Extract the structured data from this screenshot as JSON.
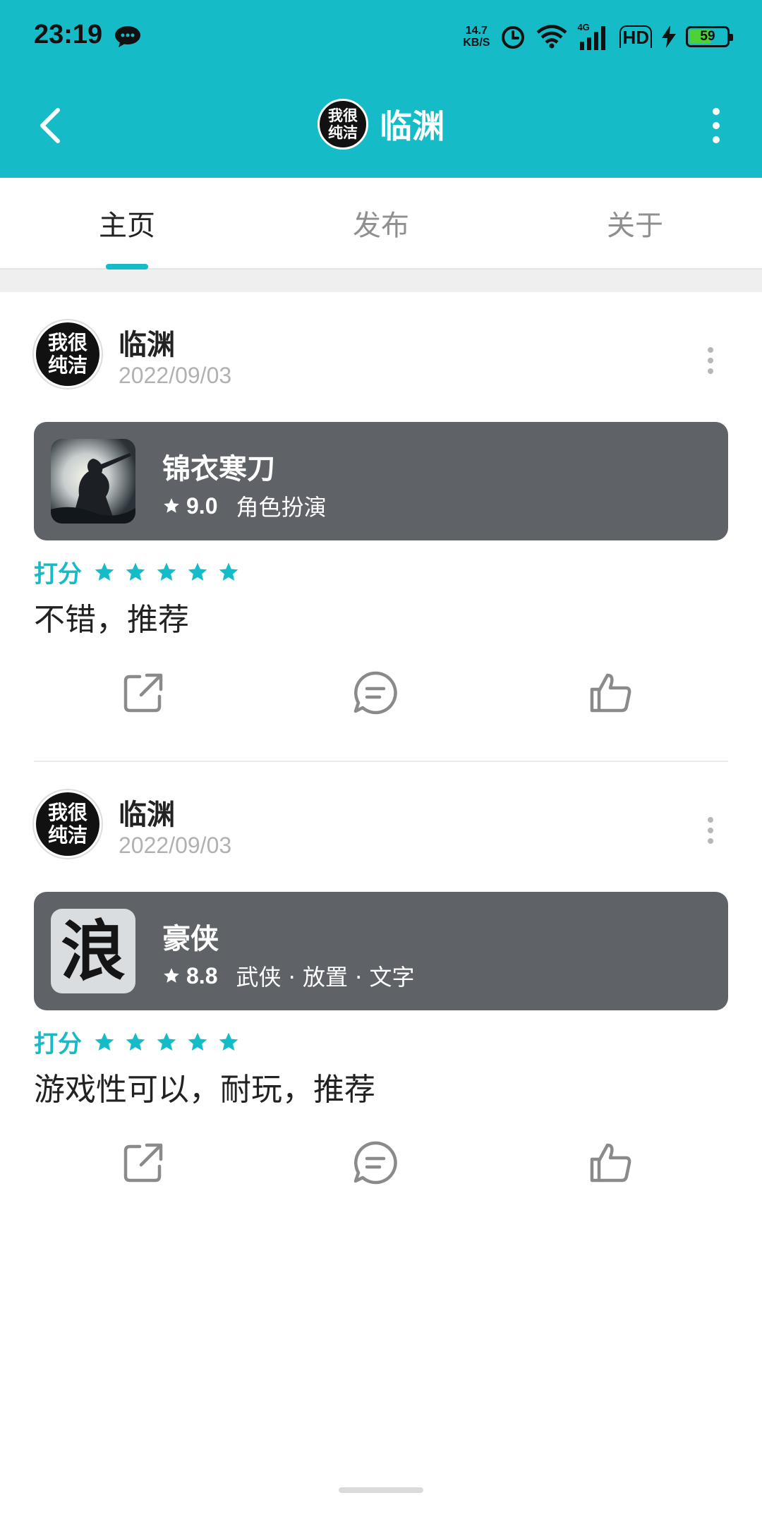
{
  "status_bar": {
    "time": "23:19",
    "net_speed_value": "14.7",
    "net_speed_unit": "KB/S",
    "network_type": "4G",
    "hd": "HD",
    "battery": "59",
    "battery_level": 0.59
  },
  "header": {
    "logo_line1": "我很",
    "logo_line2": "纯洁",
    "title": "临渊"
  },
  "tabs": [
    {
      "label": "主页",
      "active": true
    },
    {
      "label": "发布",
      "active": false
    },
    {
      "label": "关于",
      "active": false
    }
  ],
  "rating_label": "打分",
  "posts": [
    {
      "avatar_line1": "我很",
      "avatar_line2": "纯洁",
      "username": "临渊",
      "date": "2022/09/03",
      "game": {
        "name": "锦衣寒刀",
        "score": "9.0",
        "tags": "角色扮演"
      },
      "stars": 5,
      "review": "不错，推荐"
    },
    {
      "avatar_line1": "我很",
      "avatar_line2": "纯洁",
      "username": "临渊",
      "date": "2022/09/03",
      "game": {
        "name": "豪侠",
        "score": "8.8",
        "tags": "武侠 · 放置 · 文字",
        "icon_char": "浪"
      },
      "stars": 5,
      "review": "游戏性可以，耐玩，推荐"
    }
  ],
  "colors": {
    "accent": "#15bcc8",
    "card_bg": "#5f6368",
    "battery_fill": "#4cd137"
  },
  "icons": [
    "message-bubble-icon",
    "alarm-icon",
    "wifi-icon",
    "signal-icon",
    "charging-icon",
    "back-arrow-icon",
    "more-vertical-icon",
    "share-icon",
    "comment-icon",
    "thumbs-up-icon",
    "star-icon"
  ]
}
